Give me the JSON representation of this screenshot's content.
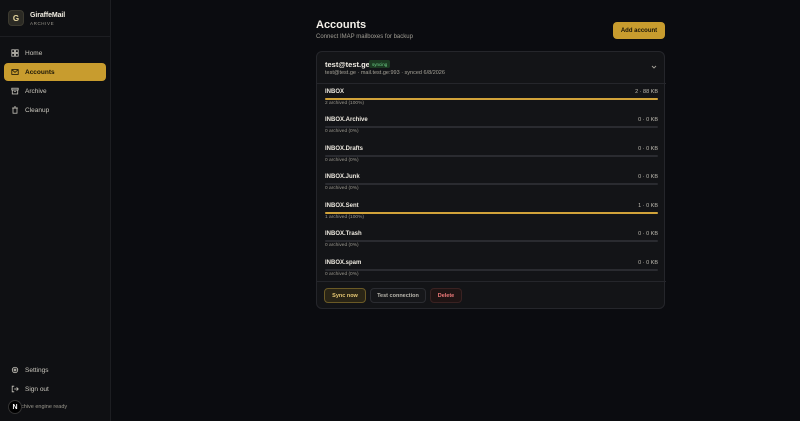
{
  "brand": {
    "logo_letter": "G",
    "name": "GiraffeMail",
    "subtitle": "ARCHIVE"
  },
  "sidebar": {
    "items": [
      {
        "label": "Home",
        "icon": "home-icon",
        "active": false
      },
      {
        "label": "Accounts",
        "icon": "mail-icon",
        "active": true
      },
      {
        "label": "Archive",
        "icon": "archive-icon",
        "active": false
      },
      {
        "label": "Cleanup",
        "icon": "trash-icon",
        "active": false
      }
    ],
    "bottom": [
      {
        "label": "Settings",
        "icon": "gear-icon"
      },
      {
        "label": "Sign out",
        "icon": "sign-out-icon"
      }
    ],
    "status": {
      "badge": "N",
      "text": "chive engine ready"
    }
  },
  "header": {
    "title": "Accounts",
    "subtitle": "Connect IMAP mailboxes for backup",
    "add_label": "Add account"
  },
  "account": {
    "email": "test@test.ge",
    "badge": "syncing",
    "meta": "test@test.ge · mail.test.ge:993 · synced 6/8/2026",
    "folders": [
      {
        "name": "INBOX",
        "stats": "2 · 88 KB",
        "archived": "2 archived (100%)",
        "progress": 1.0
      },
      {
        "name": "INBOX.Archive",
        "stats": "0 · 0 KB",
        "archived": "0 archived (0%)",
        "progress": 0.0
      },
      {
        "name": "INBOX.Drafts",
        "stats": "0 · 0 KB",
        "archived": "0 archived (0%)",
        "progress": 0.0
      },
      {
        "name": "INBOX.Junk",
        "stats": "0 · 0 KB",
        "archived": "0 archived (0%)",
        "progress": 0.0
      },
      {
        "name": "INBOX.Sent",
        "stats": "1 · 0 KB",
        "archived": "1 archived (100%)",
        "progress": 1.0
      },
      {
        "name": "INBOX.Trash",
        "stats": "0 · 0 KB",
        "archived": "0 archived (0%)",
        "progress": 0.0
      },
      {
        "name": "INBOX.spam",
        "stats": "0 · 0 KB",
        "archived": "0 archived (0%)",
        "progress": 0.0
      }
    ],
    "actions": {
      "sync": "Sync now",
      "test": "Test connection",
      "delete": "Delete"
    }
  },
  "colors": {
    "accent": "#c89c2e",
    "bar": "#d1a33a",
    "danger": "#f07a7a",
    "success": "#6fd38a"
  }
}
